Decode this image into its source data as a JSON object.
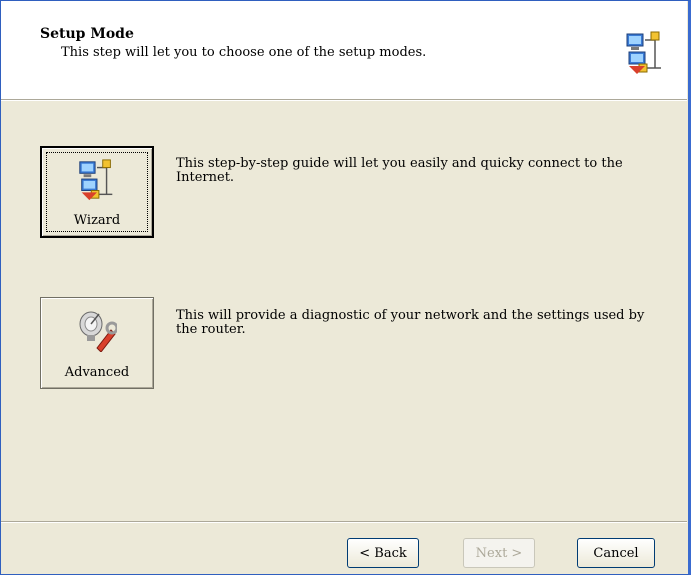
{
  "header": {
    "title": "Setup Mode",
    "subtitle": "This step will let you to choose one of the setup modes.",
    "icon": "network-computers-icon"
  },
  "modes": {
    "wizard": {
      "label": "Wizard",
      "icon": "network-computers-icon",
      "description": "This step-by-step guide will let you easily and quicky connect to the Internet."
    },
    "advanced": {
      "label": "Advanced",
      "icon": "satellite-wrench-icon",
      "description": "This will provide a diagnostic of your network and the settings used by the router."
    }
  },
  "footer": {
    "back_label": "< Back",
    "next_label": "Next >",
    "cancel_label": "Cancel"
  },
  "colors": {
    "dialog_bg": "#ece9d8",
    "header_bg": "#ffffff",
    "window_border": "#2f5fbf",
    "disabled_text": "#aca899"
  }
}
